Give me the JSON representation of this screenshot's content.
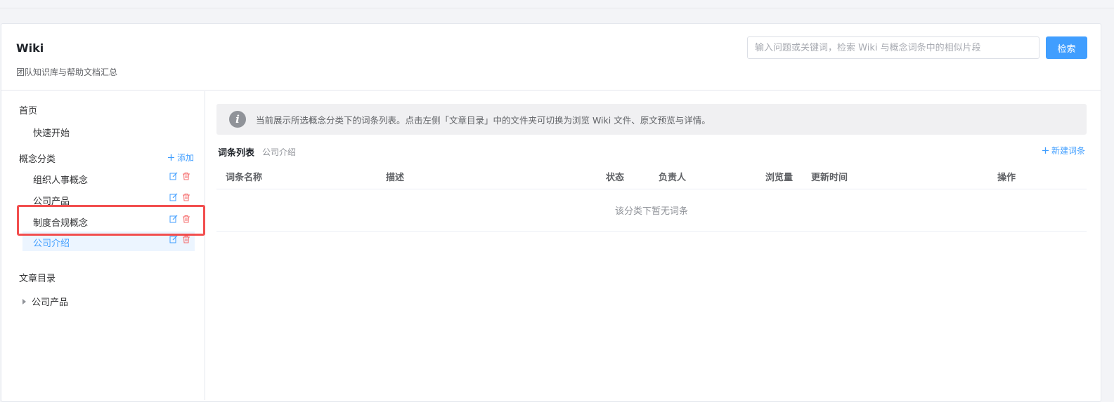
{
  "header": {
    "title": "Wiki",
    "subtitle": "团队知识库与帮助文档汇总",
    "search": {
      "placeholder": "输入问题或关键词，检索 Wiki 与概念词条中的相似片段",
      "button_label": "检索"
    }
  },
  "sidebar": {
    "home_heading": "首页",
    "quick_start": "快速开始",
    "concepts_heading": "概念分类",
    "add_label": "添加",
    "categories": [
      {
        "label": "组织人事概念",
        "active": false
      },
      {
        "label": "公司产品",
        "active": false
      },
      {
        "label": "制度合规概念",
        "active": false
      },
      {
        "label": "公司介绍",
        "active": true
      }
    ],
    "articles_heading": "文章目录",
    "articles": [
      {
        "label": "公司产品"
      }
    ]
  },
  "main": {
    "info_text": "当前展示所选概念分类下的词条列表。点击左侧「文章目录」中的文件夹可切换为浏览 Wiki 文件、原文预览与详情。",
    "list_title": "词条列表",
    "list_subtitle": "公司介绍",
    "new_entry_label": "新建词条",
    "columns": [
      "词条名称",
      "描述",
      "状态",
      "负责人",
      "浏览量",
      "更新时间",
      "操作"
    ],
    "empty_text": "该分类下暂无词条"
  },
  "colors": {
    "accent": "#409eff",
    "danger": "#f56c6c",
    "highlight": "#f24e4e"
  },
  "icons": {
    "edit": "edit-icon",
    "delete": "trash-icon",
    "plus": "plus-icon",
    "info": "info-icon",
    "caret": "caret-right-icon"
  }
}
